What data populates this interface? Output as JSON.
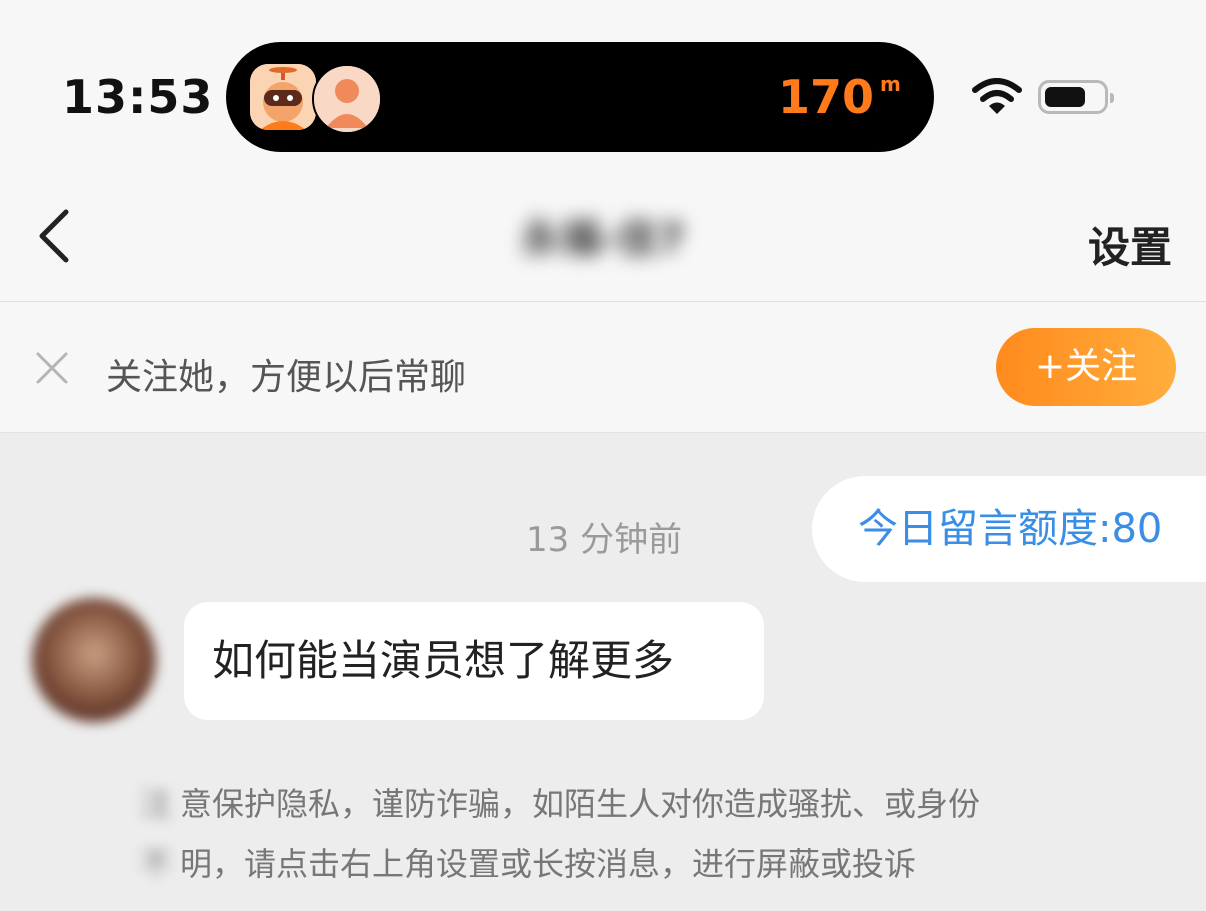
{
  "status_bar": {
    "time": "13:53",
    "island_distance": "170",
    "island_distance_unit": "m",
    "accent": "#ff7a1a"
  },
  "nav": {
    "title": "永福-佳7",
    "settings_label": "设置",
    "back_icon": "chevron-left-icon"
  },
  "follow_bar": {
    "text": "关注她，方便以后常聊",
    "button_label": "+关注",
    "close_icon": "close-icon"
  },
  "chat": {
    "timestamp": "13 分钟前",
    "quota": "今日留言额度:80",
    "message": "如何能当演员想了解更多",
    "notice_line1_lead": "注",
    "notice_line1": "意保护隐私，谨防诈骗，如陌生人对你造成骚扰、或身份",
    "notice_line2_lead": "不",
    "notice_line2": "明，请点击右上角设置或长按消息，进行屏蔽或投诉"
  },
  "colors": {
    "follow_button": "#ff8a1c",
    "quota_text": "#3a8ee6",
    "background": "#ededed"
  }
}
